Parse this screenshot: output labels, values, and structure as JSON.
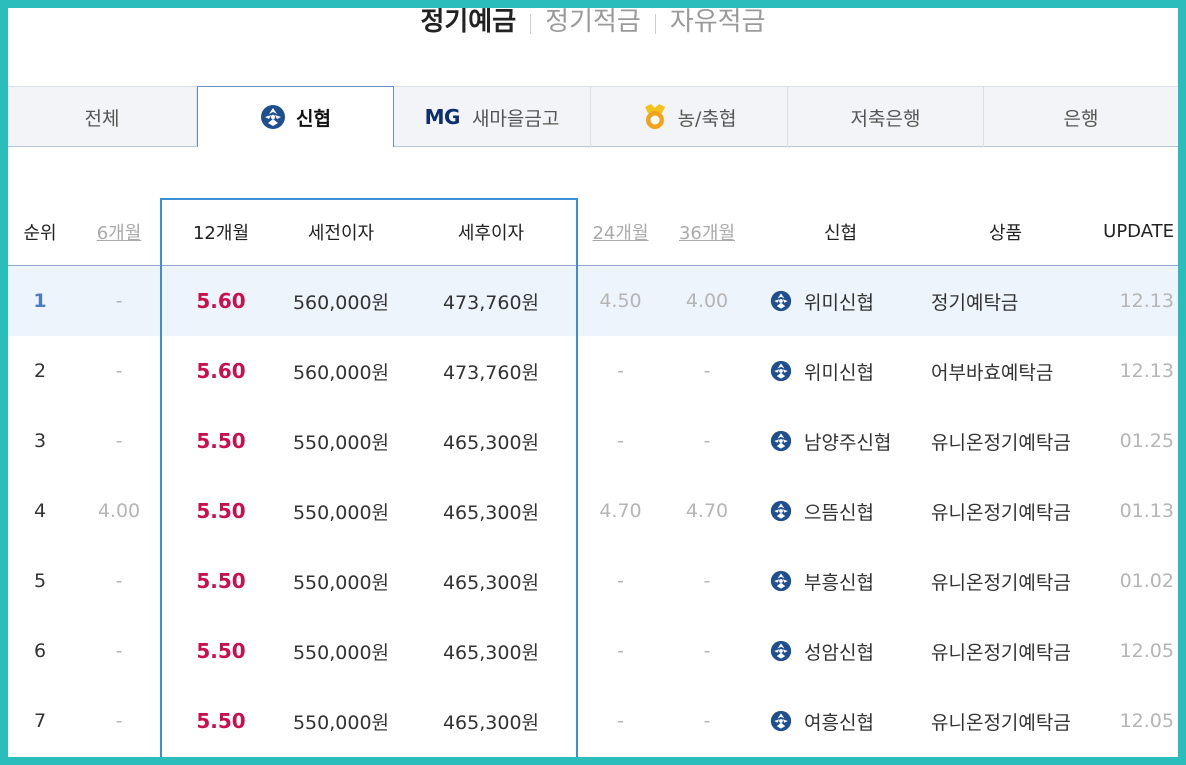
{
  "top_tabs": [
    "정기예금",
    "정기적금",
    "자유적금"
  ],
  "inst_tabs": [
    {
      "label": "전체",
      "icon": ""
    },
    {
      "label": "신협",
      "icon": "shinhyup-logo-icon"
    },
    {
      "label": "새마을금고",
      "icon": "mg-logo-icon",
      "logo_text": "MG"
    },
    {
      "label": "농/축협",
      "icon": "nonghyup-logo-icon"
    },
    {
      "label": "저축은행",
      "icon": ""
    },
    {
      "label": "은행",
      "icon": ""
    }
  ],
  "table": {
    "headers": {
      "rank": "순위",
      "m6": "6개월",
      "m12": "12개월",
      "pre_tax": "세전이자",
      "post_tax": "세후이자",
      "m24": "24개월",
      "m36": "36개월",
      "bank": "신협",
      "product": "상품",
      "update": "UPDATE"
    },
    "rows": [
      {
        "rank": "1",
        "m6": "-",
        "m12": "5.60",
        "pre": "560,000원",
        "post": "473,760원",
        "m24": "4.50",
        "m36": "4.00",
        "bank": "위미신협",
        "product": "정기예탁금",
        "update": "12.13"
      },
      {
        "rank": "2",
        "m6": "-",
        "m12": "5.60",
        "pre": "560,000원",
        "post": "473,760원",
        "m24": "-",
        "m36": "-",
        "bank": "위미신협",
        "product": "어부바효예탁금",
        "update": "12.13"
      },
      {
        "rank": "3",
        "m6": "-",
        "m12": "5.50",
        "pre": "550,000원",
        "post": "465,300원",
        "m24": "-",
        "m36": "-",
        "bank": "남양주신협",
        "product": "유니온정기예탁금",
        "update": "01.25"
      },
      {
        "rank": "4",
        "m6": "4.00",
        "m12": "5.50",
        "pre": "550,000원",
        "post": "465,300원",
        "m24": "4.70",
        "m36": "4.70",
        "bank": "으뜸신협",
        "product": "유니온정기예탁금",
        "update": "01.13"
      },
      {
        "rank": "5",
        "m6": "-",
        "m12": "5.50",
        "pre": "550,000원",
        "post": "465,300원",
        "m24": "-",
        "m36": "-",
        "bank": "부흥신협",
        "product": "유니온정기예탁금",
        "update": "01.02"
      },
      {
        "rank": "6",
        "m6": "-",
        "m12": "5.50",
        "pre": "550,000원",
        "post": "465,300원",
        "m24": "-",
        "m36": "-",
        "bank": "성암신협",
        "product": "유니온정기예탁금",
        "update": "12.05"
      },
      {
        "rank": "7",
        "m6": "-",
        "m12": "5.50",
        "pre": "550,000원",
        "post": "465,300원",
        "m24": "-",
        "m36": "-",
        "bank": "여흥신협",
        "product": "유니온정기예탁금",
        "update": "12.05"
      }
    ]
  },
  "colors": {
    "frame": "#2bbcbc",
    "rate": "#c8104f",
    "highlight_box": "#3d8fd6",
    "highlight_row": "#eef4fc"
  }
}
